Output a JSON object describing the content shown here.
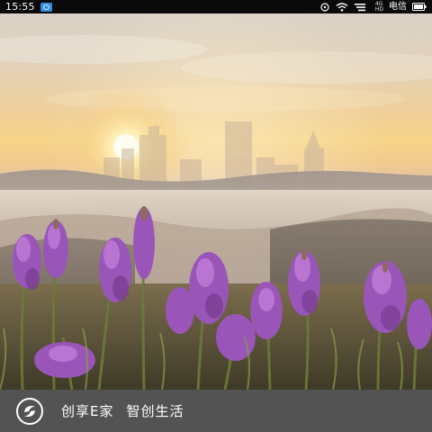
{
  "status_bar": {
    "time": "15:55",
    "carrier": "电信",
    "icons": [
      "notification-icon",
      "alarm-icon",
      "wifi-icon",
      "signal-icon",
      "battery-icon"
    ]
  },
  "splash": {
    "background": "sunrise-city-lavender-photo"
  },
  "brand": {
    "name": "创享E家",
    "slogan": "智创生活",
    "logo_icon": "brand-logo-icon",
    "bar_color": "#535353"
  }
}
